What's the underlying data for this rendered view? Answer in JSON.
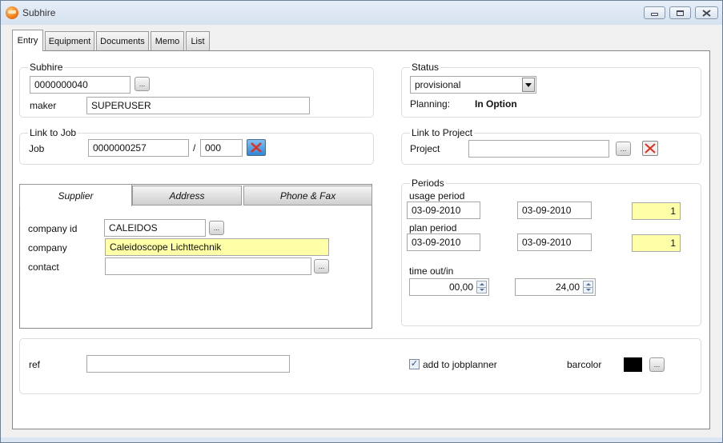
{
  "window": {
    "title": "Subhire",
    "controls": {
      "minimize": "minimize",
      "maximize": "maximize",
      "close": "close"
    }
  },
  "main_tabs": [
    {
      "label": "Entry",
      "active": true
    },
    {
      "label": "Equipment",
      "active": false
    },
    {
      "label": "Documents",
      "active": false
    },
    {
      "label": "Memo",
      "active": false
    },
    {
      "label": "List",
      "active": false
    }
  ],
  "subhire": {
    "title": "Subhire",
    "number": "0000000040",
    "browse_label": "...",
    "maker_label": "maker",
    "maker": "SUPERUSER"
  },
  "link_job": {
    "title": "Link to Job",
    "job_label": "Job",
    "job_number": "0000000257",
    "separator": "/",
    "job_sub": "000",
    "clear_icon": "clear-link-icon"
  },
  "status": {
    "title": "Status",
    "selected": "provisional",
    "planning_label": "Planning:",
    "planning_value": "In Option"
  },
  "link_project": {
    "title": "Link to Project",
    "project_label": "Project",
    "project_value": "",
    "browse_label": "...",
    "clear_icon": "red-x-icon"
  },
  "supplier_tabs": [
    {
      "label": "Supplier",
      "active": true
    },
    {
      "label": "Address",
      "active": false
    },
    {
      "label": "Phone & Fax",
      "active": false
    }
  ],
  "supplier": {
    "company_id_label": "company id",
    "company_id": "CALEIDOS",
    "company_label": "company",
    "company": "Caleidoscope Lichttechnik",
    "contact_label": "contact",
    "contact": "",
    "browse_label": "..."
  },
  "periods": {
    "title": "Periods",
    "usage_label": "usage period",
    "usage_start": "03-09-2010",
    "usage_end": "03-09-2010",
    "usage_days": "1",
    "plan_label": "plan period",
    "plan_start": "03-09-2010",
    "plan_end": "03-09-2010",
    "plan_days": "1",
    "time_label": "time out/in",
    "time_out": "00,00",
    "time_in": "24,00"
  },
  "bottom": {
    "ref_label": "ref",
    "ref": "",
    "add_to_jobplanner_label": "add to jobplanner",
    "add_to_jobplanner_checked": true,
    "check_glyph": "✓",
    "barcolor_label": "barcolor",
    "barcolor": "#000000",
    "browse_label": "..."
  }
}
